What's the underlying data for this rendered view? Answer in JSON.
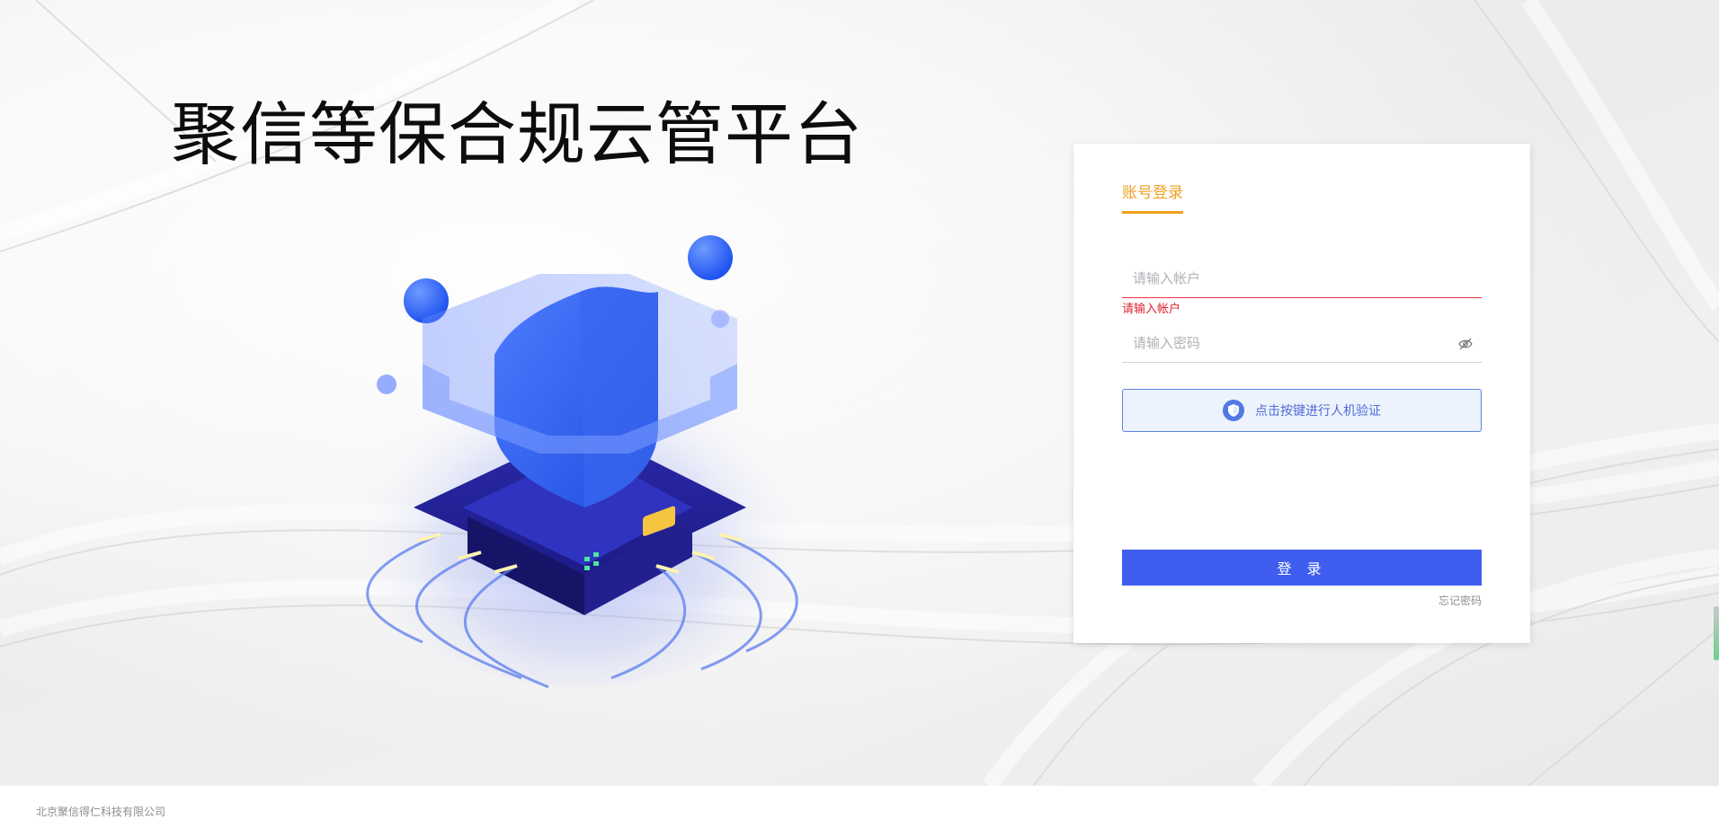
{
  "app": {
    "title": "聚信等保合规云管平台"
  },
  "login": {
    "tab_label": "账号登录",
    "account_placeholder": "请输入帐户",
    "account_value": "",
    "account_error": "请输入帐户",
    "password_placeholder": "请输入密码",
    "password_value": "",
    "password_toggle_icon": "eye-slash-icon",
    "captcha_label": "点击按键进行人机验证",
    "captcha_icon": "shield-check-icon",
    "submit_label": "登 录",
    "forgot_label": "忘记密码"
  },
  "footer": {
    "copyright": "北京聚信得仁科技有限公司"
  },
  "colors": {
    "accent_tab": "#f0a020",
    "error": "#e0202e",
    "primary_button": "#3f5ef0",
    "captcha_border": "#5b82e4",
    "captcha_bg": "#edf3fd"
  }
}
